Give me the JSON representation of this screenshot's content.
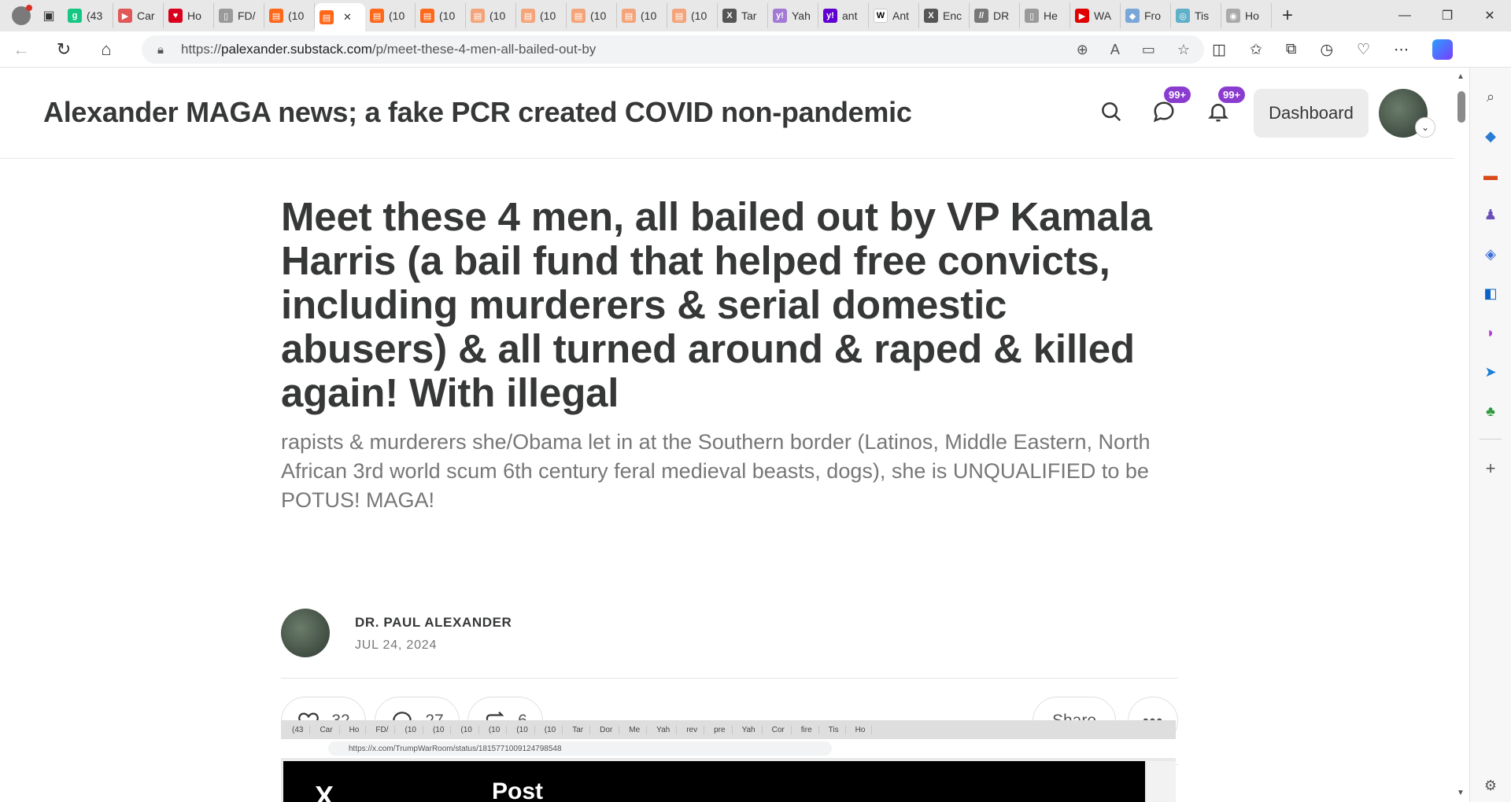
{
  "browser": {
    "tabs": [
      {
        "label": "(43",
        "icon": "g-icon",
        "color": "#16c784",
        "glyph": "g"
      },
      {
        "label": "Car",
        "icon": "youtube-icon",
        "color": "#e05858",
        "glyph": "▶"
      },
      {
        "label": "Ho",
        "icon": "shield-icon",
        "color": "#d8001c",
        "glyph": "♥"
      },
      {
        "label": "FD/",
        "icon": "document-icon",
        "color": "#9a9a9a",
        "glyph": "▯"
      },
      {
        "label": "(10",
        "icon": "substack-icon",
        "color": "#ff6719",
        "glyph": "▤"
      },
      {
        "label": "",
        "icon": "substack-icon",
        "color": "#ff6719",
        "glyph": "▤",
        "active": true
      },
      {
        "label": "(10",
        "icon": "substack-icon",
        "color": "#ff6719",
        "glyph": "▤"
      },
      {
        "label": "(10",
        "icon": "substack-icon",
        "color": "#ff6719",
        "glyph": "▤"
      },
      {
        "label": "(10",
        "icon": "substack-icon",
        "color": "#f4a47a",
        "glyph": "▤"
      },
      {
        "label": "(10",
        "icon": "substack-icon",
        "color": "#f4a47a",
        "glyph": "▤"
      },
      {
        "label": "(10",
        "icon": "substack-icon",
        "color": "#f4a47a",
        "glyph": "▤"
      },
      {
        "label": "(10",
        "icon": "substack-icon",
        "color": "#f4a47a",
        "glyph": "▤"
      },
      {
        "label": "(10",
        "icon": "substack-icon",
        "color": "#f4a47a",
        "glyph": "▤"
      },
      {
        "label": "Tar",
        "icon": "x-icon",
        "color": "#555555",
        "glyph": "X"
      },
      {
        "label": "Yah",
        "icon": "yahoo-icon",
        "color": "#a27ad6",
        "glyph": "y!"
      },
      {
        "label": "ant",
        "icon": "yahoo-icon",
        "color": "#6001d2",
        "glyph": "y!"
      },
      {
        "label": "Ant",
        "icon": "wikipedia-icon",
        "color": "#ffffff",
        "glyph": "W"
      },
      {
        "label": "Enc",
        "icon": "x-icon",
        "color": "#555555",
        "glyph": "X"
      },
      {
        "label": "DR",
        "icon": "slash-icon",
        "color": "#777777",
        "glyph": "//"
      },
      {
        "label": "He",
        "icon": "document-icon",
        "color": "#9a9a9a",
        "glyph": "▯"
      },
      {
        "label": "WA",
        "icon": "youtube-icon",
        "color": "#e00000",
        "glyph": "▶"
      },
      {
        "label": "Fro",
        "icon": "photo-icon",
        "color": "#7aa7d9",
        "glyph": "◆"
      },
      {
        "label": "Tis",
        "icon": "globe-icon",
        "color": "#5fb0c8",
        "glyph": "◎"
      },
      {
        "label": "Ho",
        "icon": "eye-icon",
        "color": "#aaaaaa",
        "glyph": "◉"
      }
    ],
    "url_prefix": "https://",
    "url_host": "palexander.substack.com",
    "url_path": "/p/meet-these-4-men-all-bailed-out-by"
  },
  "site": {
    "title": "Alexander MAGA news; a fake PCR created COVID non-pandemic",
    "chat_badge": "99+",
    "notif_badge": "99+",
    "dashboard_label": "Dashboard"
  },
  "post": {
    "headline": "Meet these 4 men, all bailed out by VP Kamala Harris (a bail fund that helped free convicts, including murderers & serial domestic abusers) & all turned around & raped & killed again! With illegal",
    "subtitle": "rapists & murderers she/Obama let in at the Southern border (Latinos, Middle Eastern, North African 3rd world scum 6th century feral medieval beasts, dogs), she is UNQUALIFIED to be POTUS! MAGA!",
    "author": "DR. PAUL ALEXANDER",
    "date": "JUL 24, 2024",
    "likes": "32",
    "comments": "27",
    "restacks": "6",
    "share_label": "Share"
  },
  "embed": {
    "tabs": [
      "(43",
      "Car",
      "Ho",
      "FD/",
      "(10",
      "(10",
      "(10",
      "(10",
      "(10",
      "(10",
      "Tar",
      "Dor",
      "Me",
      "Yah",
      "rev",
      "pre",
      "Yah",
      "Cor",
      "fire",
      "Tis",
      "Ho"
    ],
    "url": "https://x.com/TrumpWarRoom/status/1815771009124798548",
    "post_title": "Post"
  },
  "colors": {
    "badge": "#8a3ccf",
    "substack_orange": "#ff6719",
    "text": "#363737"
  }
}
